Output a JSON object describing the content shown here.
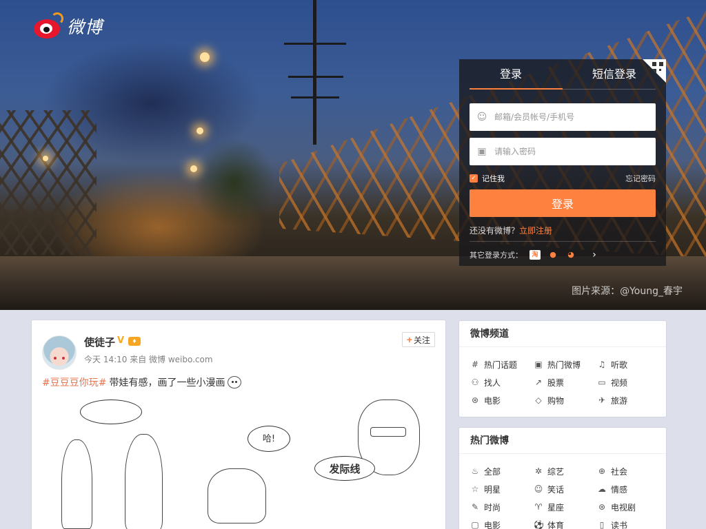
{
  "brand": {
    "logo_text": "微博"
  },
  "hero": {
    "photo_credit": "图片来源：@Young_春宇"
  },
  "login": {
    "tabs": [
      "登录",
      "短信登录"
    ],
    "account_placeholder": "邮箱/会员帐号/手机号",
    "password_placeholder": "请输入密码",
    "remember_label": "记住我",
    "remember_checked": true,
    "forgot_label": "忘记密码",
    "submit_label": "登录",
    "no_account_text": "还没有微博？",
    "register_link": "立即注册",
    "other_methods_label": "其它登录方式：",
    "other_methods_icons": [
      "taobao-icon",
      "qq-icon",
      "weibo-icon",
      "chevron-right-icon"
    ],
    "accent_color": "#ff8140"
  },
  "feed": {
    "post": {
      "username": "使徒子",
      "verified_badge": "V",
      "member_badge": "",
      "meta": "今天 14:10 来自 微博 weibo.com",
      "follow_label": "关注",
      "topic": "#豆豆豆你玩#",
      "text": "带娃有感，画了一些小漫画",
      "comic_texts": [
        "哈!",
        "发际线"
      ],
      "topic_color": "#eb7350"
    }
  },
  "sidebar": {
    "channels": {
      "title": "微博频道",
      "items": [
        {
          "icon": "hash-icon",
          "glyph": "#",
          "label": "热门话题"
        },
        {
          "icon": "fire-doc-icon",
          "glyph": "▣",
          "label": "热门微博"
        },
        {
          "icon": "music-icon",
          "glyph": "♫",
          "label": "听歌"
        },
        {
          "icon": "people-icon",
          "glyph": "⚇",
          "label": "找人"
        },
        {
          "icon": "stock-icon",
          "glyph": "↗",
          "label": "股票"
        },
        {
          "icon": "video-icon",
          "glyph": "▭",
          "label": "视频"
        },
        {
          "icon": "film-icon",
          "glyph": "⊛",
          "label": "电影"
        },
        {
          "icon": "tag-icon",
          "glyph": "◇",
          "label": "购物"
        },
        {
          "icon": "plane-icon",
          "glyph": "✈",
          "label": "旅游"
        }
      ]
    },
    "hot": {
      "title": "热门微博",
      "items": [
        {
          "icon": "fire-icon",
          "glyph": "♨",
          "label": "全部"
        },
        {
          "icon": "variety-icon",
          "glyph": "✲",
          "label": "综艺"
        },
        {
          "icon": "globe-icon",
          "glyph": "⊕",
          "label": "社会"
        },
        {
          "icon": "star-icon",
          "glyph": "☆",
          "label": "明星"
        },
        {
          "icon": "smile-icon",
          "glyph": "☺",
          "label": "笑话"
        },
        {
          "icon": "cloud-icon",
          "glyph": "☁",
          "label": "情感"
        },
        {
          "icon": "fashion-icon",
          "glyph": "✎",
          "label": "时尚"
        },
        {
          "icon": "aries-icon",
          "glyph": "♈",
          "label": "星座"
        },
        {
          "icon": "tv-icon",
          "glyph": "⊛",
          "label": "电视剧"
        },
        {
          "icon": "movie-icon",
          "glyph": "▢",
          "label": "电影"
        },
        {
          "icon": "sports-icon",
          "glyph": "⚽",
          "label": "体育"
        },
        {
          "icon": "book-icon",
          "glyph": "▯",
          "label": "读书"
        }
      ]
    }
  }
}
